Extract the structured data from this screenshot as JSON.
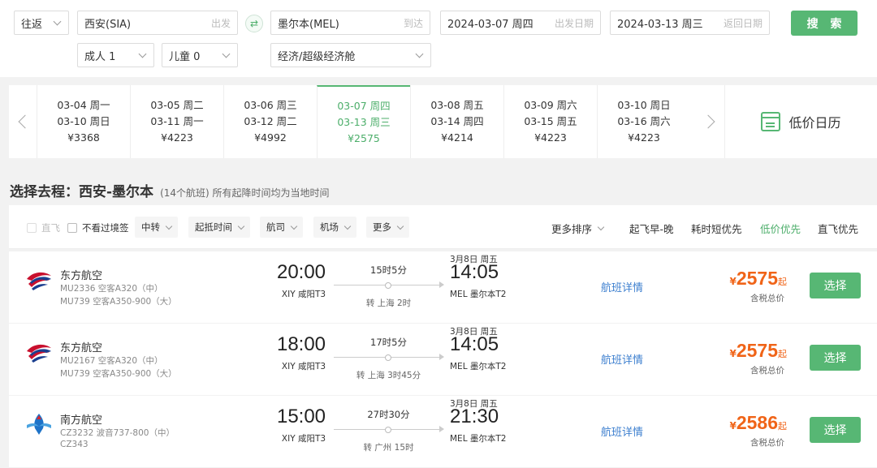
{
  "search": {
    "trip_type": "往返",
    "from_value": "西安(SIA)",
    "from_placeholder": "出发",
    "to_value": "墨尔本(MEL)",
    "to_placeholder": "到达",
    "depart_date": "2024-03-07 周四",
    "depart_placeholder": "出发日期",
    "return_date": "2024-03-13 周三",
    "return_placeholder": "返回日期",
    "search_label": "搜 索",
    "adults": "成人 1",
    "children": "儿童 0",
    "cabin": "经济/超级经济舱",
    "swap_icon": "swap-icon"
  },
  "dates": [
    {
      "dep": "03-04 周一",
      "ret": "03-10 周日",
      "price": "¥3368"
    },
    {
      "dep": "03-05 周二",
      "ret": "03-11 周一",
      "price": "¥4223"
    },
    {
      "dep": "03-06 周三",
      "ret": "03-12 周二",
      "price": "¥4992"
    },
    {
      "dep": "03-07 周四",
      "ret": "03-13 周三",
      "price": "¥2575",
      "active": true
    },
    {
      "dep": "03-08 周五",
      "ret": "03-14 周四",
      "price": "¥4214"
    },
    {
      "dep": "03-09 周六",
      "ret": "03-15 周五",
      "price": "¥4223"
    },
    {
      "dep": "03-10 周日",
      "ret": "03-16 周六",
      "price": "¥4223"
    }
  ],
  "calendar_label": "低价日历",
  "section": {
    "title": "选择去程：西安-墨尔本",
    "subtitle": "(14个航班) 所有起降时间均为当地时间"
  },
  "filters": {
    "direct": "直飞",
    "no_transit_visa": "不看过境签",
    "buttons": [
      "中转",
      "起抵时间",
      "航司",
      "机场",
      "更多"
    ],
    "sorts": [
      "更多排序",
      "起飞早-晚",
      "耗时短优先",
      "低价优先",
      "直飞优先"
    ],
    "active_sort": "低价优先"
  },
  "flights": [
    {
      "airline": "东方航空",
      "seg1": "MU2336 空客A320（中）",
      "seg2": "MU739 空客A350-900（大）",
      "dep_time": "20:00",
      "dep_airport": "XIY 咸阳T3",
      "duration": "15时5分",
      "transfer": "转 上海 2时",
      "arr_date": "3月8日 周五",
      "arr_time": "14:05",
      "arr_airport": "MEL 墨尔本T2",
      "detail": "航班详情",
      "currency": "¥",
      "price": "2575",
      "price_suffix": "起",
      "price_note": "含税总价",
      "select": "选择",
      "logo": "china-eastern-logo"
    },
    {
      "airline": "东方航空",
      "seg1": "MU2167 空客A320（中）",
      "seg2": "MU739 空客A350-900（大）",
      "dep_time": "18:00",
      "dep_airport": "XIY 咸阳T3",
      "duration": "17时5分",
      "transfer": "转 上海 3时45分",
      "arr_date": "3月8日 周五",
      "arr_time": "14:05",
      "arr_airport": "MEL 墨尔本T2",
      "detail": "航班详情",
      "currency": "¥",
      "price": "2575",
      "price_suffix": "起",
      "price_note": "含税总价",
      "select": "选择",
      "logo": "china-eastern-logo"
    },
    {
      "airline": "南方航空",
      "seg1": "CZ3232 波音737-800（中）",
      "seg2": "CZ343",
      "dep_time": "15:00",
      "dep_airport": "XIY 咸阳T3",
      "duration": "27时30分",
      "transfer": "转 广州 15时",
      "arr_date": "3月8日 周五",
      "arr_time": "21:30",
      "arr_airport": "MEL 墨尔本T2",
      "detail": "航班详情",
      "currency": "¥",
      "price": "2586",
      "price_suffix": "起",
      "price_note": "含税总价",
      "select": "选择",
      "logo": "china-southern-logo"
    }
  ],
  "colors": {
    "accent": "#57b774",
    "price": "#f06418",
    "link": "#3d7fcf"
  }
}
